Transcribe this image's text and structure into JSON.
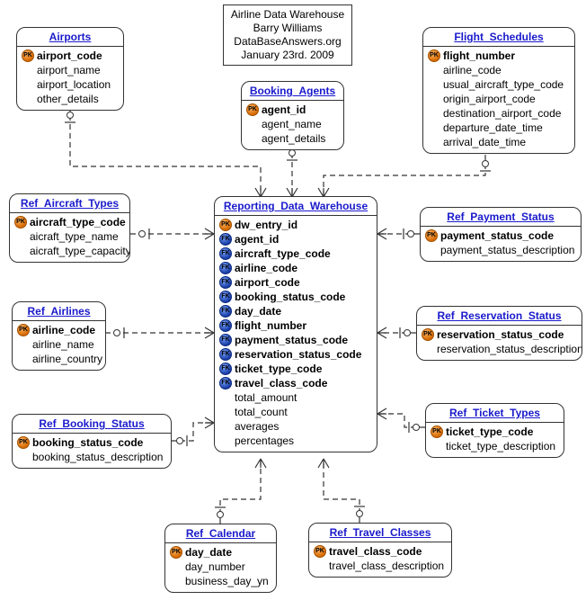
{
  "info": {
    "line1": "Airline Data Warehouse",
    "line2": "Barry Williams",
    "line3": "DataBaseAnswers.org",
    "line4": "January 23rd. 2009"
  },
  "entities": {
    "airports": {
      "title": "Airports",
      "attrs": [
        {
          "name": "airport_code",
          "key": "pk"
        },
        {
          "name": "airport_name"
        },
        {
          "name": "airport_location"
        },
        {
          "name": "other_details"
        }
      ]
    },
    "booking_agents": {
      "title": "Booking_Agents",
      "attrs": [
        {
          "name": "agent_id",
          "key": "pk"
        },
        {
          "name": "agent_name"
        },
        {
          "name": "agent_details"
        }
      ]
    },
    "flight_schedules": {
      "title": "Flight_Schedules",
      "attrs": [
        {
          "name": "flight_number",
          "key": "pk"
        },
        {
          "name": "airline_code"
        },
        {
          "name": "usual_aircraft_type_code"
        },
        {
          "name": "origin_airport_code"
        },
        {
          "name": "destination_airport_code"
        },
        {
          "name": "departure_date_time"
        },
        {
          "name": "arrival_date_time"
        }
      ]
    },
    "ref_aircraft_types": {
      "title": "Ref_Aircraft_Types",
      "attrs": [
        {
          "name": "aircraft_type_code",
          "key": "pk"
        },
        {
          "name": "aicraft_type_name"
        },
        {
          "name": "aicraft_type_capacity"
        }
      ]
    },
    "ref_airlines": {
      "title": "Ref_Airlines",
      "attrs": [
        {
          "name": "airline_code",
          "key": "pk"
        },
        {
          "name": "airline_name"
        },
        {
          "name": "airline_country"
        }
      ]
    },
    "ref_booking_status": {
      "title": "Ref_Booking_Status",
      "attrs": [
        {
          "name": "booking_status_code",
          "key": "pk"
        },
        {
          "name": "booking_status_description"
        }
      ]
    },
    "ref_calendar": {
      "title": "Ref_Calendar",
      "attrs": [
        {
          "name": "day_date",
          "key": "pk"
        },
        {
          "name": "day_number"
        },
        {
          "name": "business_day_yn"
        }
      ]
    },
    "ref_travel_classes": {
      "title": "Ref_Travel_Classes",
      "attrs": [
        {
          "name": "travel_class_code",
          "key": "pk"
        },
        {
          "name": "travel_class_description"
        }
      ]
    },
    "ref_ticket_types": {
      "title": "Ref_Ticket_Types",
      "attrs": [
        {
          "name": "ticket_type_code",
          "key": "pk"
        },
        {
          "name": "ticket_type_description"
        }
      ]
    },
    "ref_reservation_status": {
      "title": "Ref_Reservation_Status",
      "attrs": [
        {
          "name": "reservation_status_code",
          "key": "pk"
        },
        {
          "name": "reservation_status_description"
        }
      ]
    },
    "ref_payment_status": {
      "title": "Ref_Payment_Status",
      "attrs": [
        {
          "name": "payment_status_code",
          "key": "pk"
        },
        {
          "name": "payment_status_description"
        }
      ]
    },
    "reporting_dw": {
      "title": "Reporting_Data_Warehouse",
      "attrs": [
        {
          "name": "dw_entry_id",
          "key": "pk"
        },
        {
          "name": "agent_id",
          "key": "fk"
        },
        {
          "name": "aircraft_type_code",
          "key": "fk"
        },
        {
          "name": "airline_code",
          "key": "fk"
        },
        {
          "name": "airport_code",
          "key": "fk"
        },
        {
          "name": "booking_status_code",
          "key": "fk"
        },
        {
          "name": "day_date",
          "key": "fk"
        },
        {
          "name": "flight_number",
          "key": "fk"
        },
        {
          "name": "payment_status_code",
          "key": "fk"
        },
        {
          "name": "reservation_status_code",
          "key": "fk"
        },
        {
          "name": "ticket_type_code",
          "key": "fk"
        },
        {
          "name": "travel_class_code",
          "key": "fk"
        },
        {
          "name": "total_amount"
        },
        {
          "name": "total_count"
        },
        {
          "name": "averages"
        },
        {
          "name": "percentages"
        }
      ]
    }
  }
}
